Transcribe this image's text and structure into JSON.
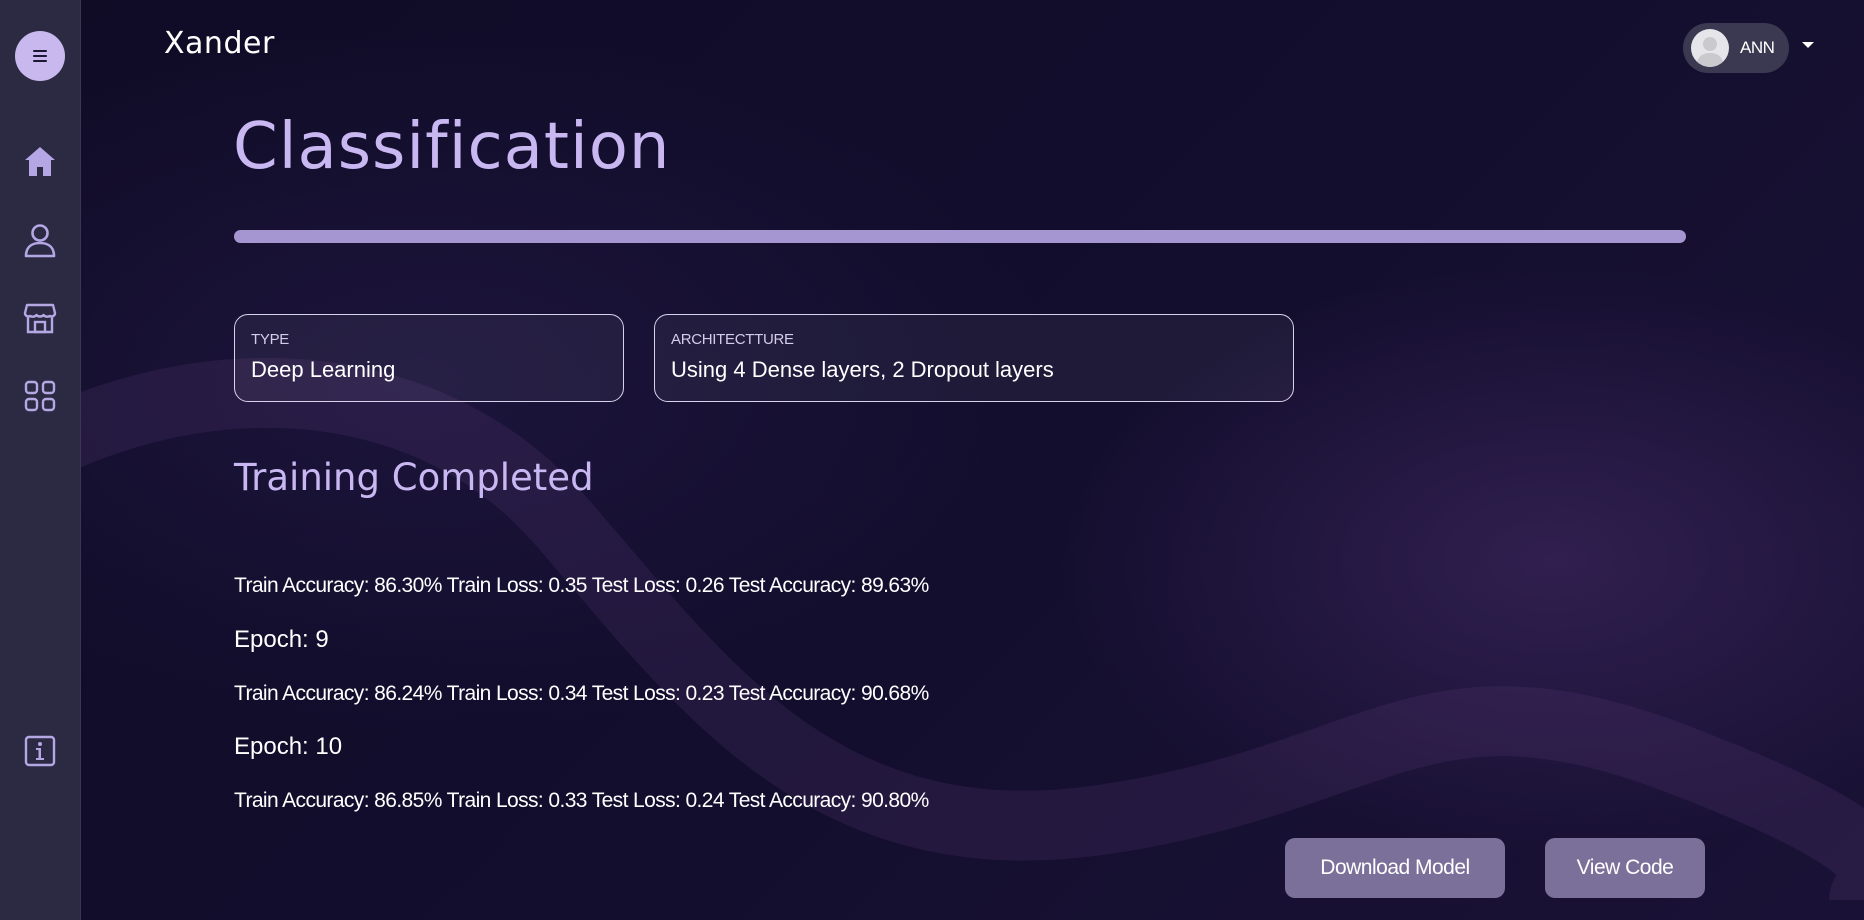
{
  "app": {
    "logo": "Xander"
  },
  "user": {
    "name": "ANN"
  },
  "sidebar": {
    "items": [
      {
        "icon": "home-icon"
      },
      {
        "icon": "user-icon"
      },
      {
        "icon": "store-icon"
      },
      {
        "icon": "grid-icon"
      },
      {
        "icon": "info-icon"
      }
    ]
  },
  "page": {
    "title": "Classification",
    "progress": 1.0
  },
  "cards": {
    "type": {
      "label": "TYPE",
      "value": "Deep Learning"
    },
    "architecture": {
      "label": "ARCHITECTTURE",
      "value": "Using 4 Dense layers, 2 Dropout layers"
    }
  },
  "training": {
    "status": "Training Completed",
    "log": [
      {
        "kind": "metrics",
        "text": "Train Accuracy: 86.30% Train Loss: 0.35 Test Loss: 0.26 Test Accuracy: 89.63%"
      },
      {
        "kind": "epoch",
        "text": "Epoch: 9"
      },
      {
        "kind": "metrics",
        "text": "Train Accuracy: 86.24% Train Loss: 0.34 Test Loss: 0.23 Test Accuracy: 90.68%"
      },
      {
        "kind": "epoch",
        "text": "Epoch: 10"
      },
      {
        "kind": "metrics",
        "text": "Train Accuracy: 86.85% Train Loss: 0.33 Test Loss: 0.24 Test Accuracy: 90.80%"
      }
    ]
  },
  "actions": {
    "download_label": "Download Model",
    "view_code_label": "View Code"
  },
  "colors": {
    "accent": "#c9b7f2",
    "sidebar": "#2c2a43",
    "button": "#7a7099",
    "background": "#0f0b24"
  }
}
